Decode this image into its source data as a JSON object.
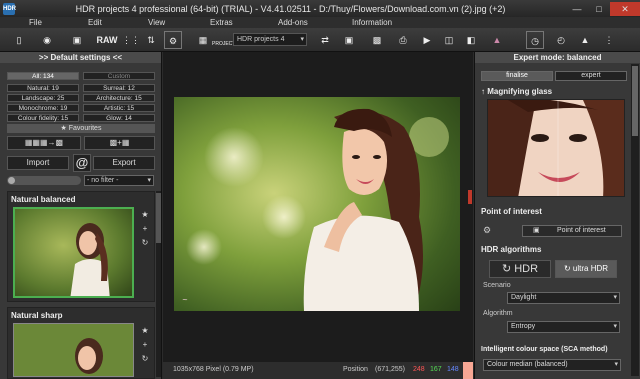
{
  "window": {
    "title": "HDR projects 4 professional (64-bit) (TRIAL) - V4.41.02511 - D:/Thuy/Flowers/Download.com.vn (2).jpg (+2)",
    "app_icon": "HDR"
  },
  "menu": {
    "items": [
      "File",
      "Edit",
      "View",
      "Extras",
      "Add-ons",
      "Information"
    ]
  },
  "toolbar": {
    "raw_label": "RAW",
    "projects_label": "PROJECTS",
    "project_select": "HDR projects 4"
  },
  "left_panel": {
    "header": ">> Default settings <<",
    "categories": [
      {
        "label": "All: 134",
        "selected": true
      },
      {
        "label": "Custom",
        "selected": false
      },
      {
        "label": "Natural: 19"
      },
      {
        "label": "Surreal: 12"
      },
      {
        "label": "Landscape: 25"
      },
      {
        "label": "Architecture: 15"
      },
      {
        "label": "Monochrome: 19"
      },
      {
        "label": "Artistic: 15"
      },
      {
        "label": "Colour fidelity: 15"
      },
      {
        "label": "Glow: 14"
      }
    ],
    "favourites": "Favourites",
    "import_label": "Import",
    "export_label": "Export",
    "at_label": "@",
    "filter_value": "- no filter -",
    "presets": [
      {
        "name": "Natural balanced",
        "selected": true
      },
      {
        "name": "Natural sharp",
        "selected": false
      }
    ]
  },
  "status": {
    "size": "1035x768 Pixel (0.79 MP)",
    "position_label": "Position",
    "coords": "(671,255)",
    "r": "248",
    "g": "167",
    "b": "148",
    "sample_color": "#f8a794"
  },
  "right_panel": {
    "header": "Expert mode: balanced",
    "mode_tabs": [
      {
        "label": "finalise",
        "selected": true
      },
      {
        "label": "expert",
        "selected": false
      }
    ],
    "magnifier_title": "Magnifying glass",
    "poi_title": "Point of interest",
    "poi_button": "Point of interest",
    "hdr_title": "HDR algorithms",
    "hdr_tabs": [
      {
        "label": "HDR",
        "selected": false
      },
      {
        "label": "ultra HDR",
        "selected": true
      }
    ],
    "scenario_label": "Scenario",
    "scenario_value": "Daylight",
    "algorithm_label": "Algorithm",
    "algorithm_value": "Entropy",
    "ics_title": "Intelligent colour space (SCA method)",
    "ics_value": "Colour median (balanced)"
  },
  "colors": {
    "accent_green": "#4caf50",
    "close_red": "#c0392b"
  }
}
